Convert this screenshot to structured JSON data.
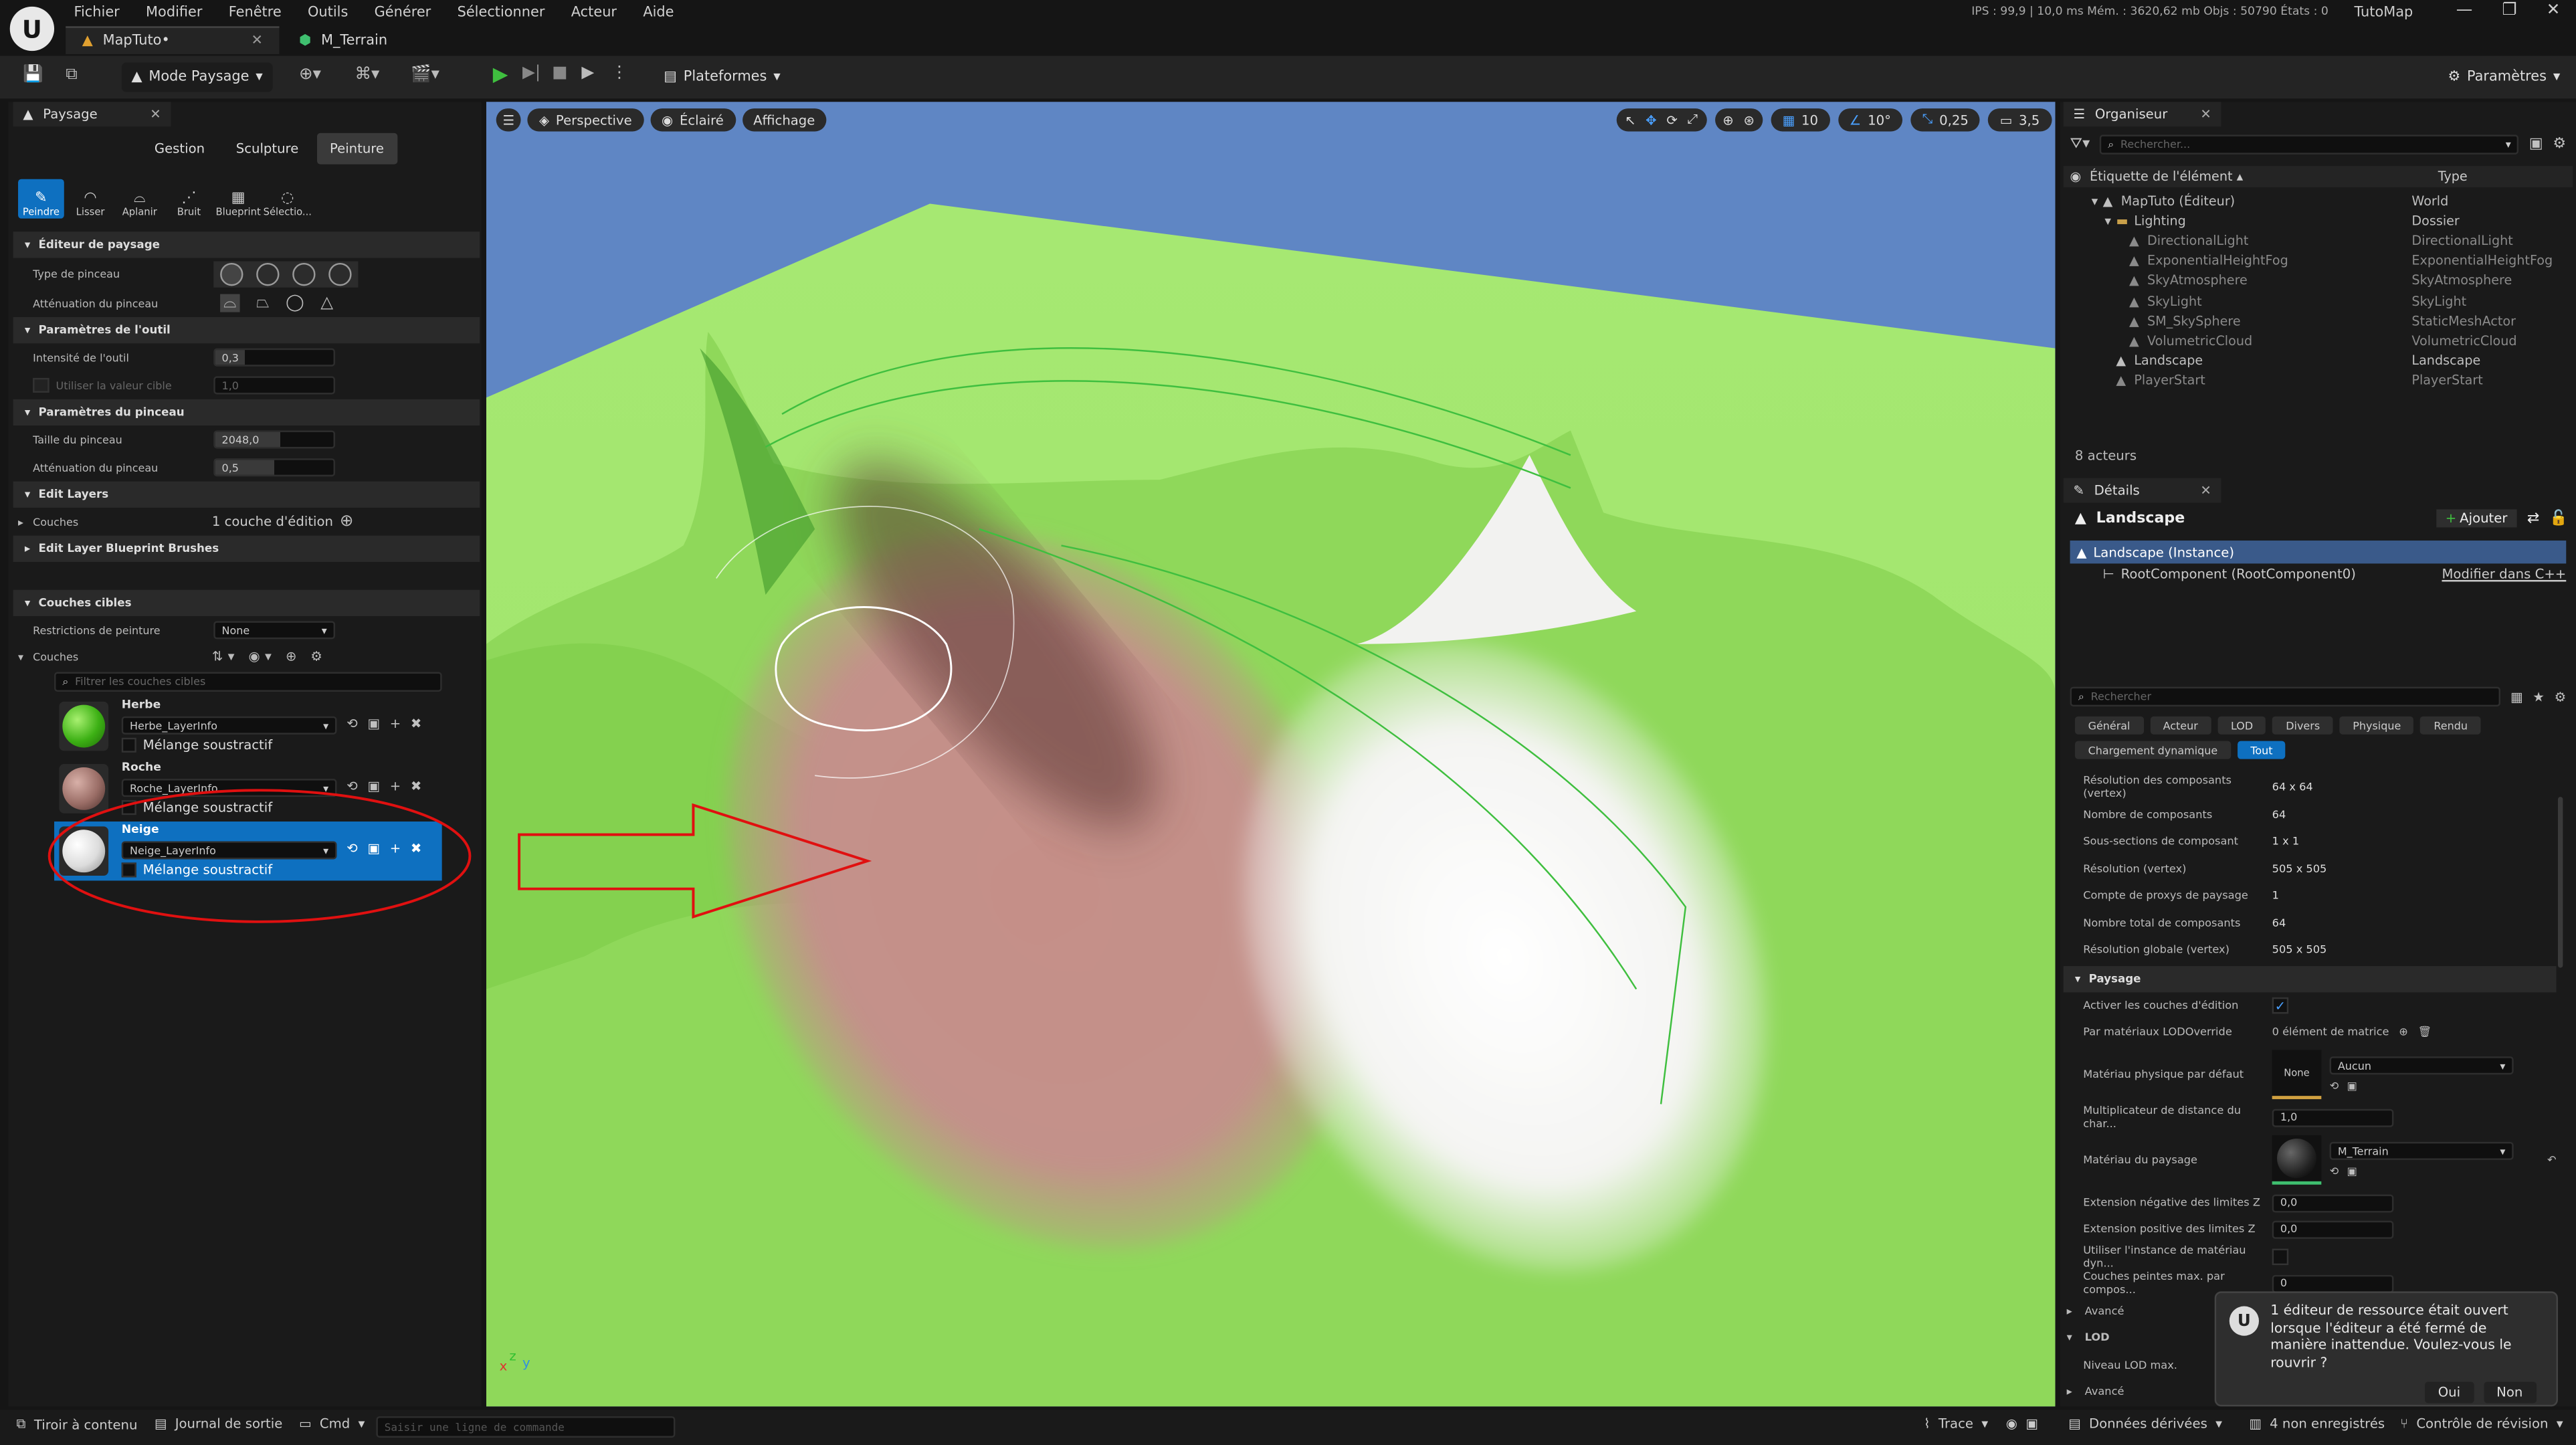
{
  "titlebar": {
    "menu": [
      "Fichier",
      "Modifier",
      "Fenêtre",
      "Outils",
      "Générer",
      "Sélectionner",
      "Acteur",
      "Aide"
    ],
    "tabs": [
      {
        "label": "MapTuto•",
        "active": true
      },
      {
        "label": "M_Terrain",
        "active": false
      }
    ],
    "stats": "IPS : 99,9  |  10,0 ms   Mém. : 3620,62 mb   Objs : 50790   États : 0",
    "project": "TutoMap",
    "window_buttons": [
      "—",
      "❐",
      "✕"
    ]
  },
  "toolbar": {
    "mode": "Mode Paysage",
    "platforms": "Plateformes",
    "settings": "Paramètres"
  },
  "left_panel": {
    "tab": "Paysage",
    "modes": [
      "Gestion",
      "Sculpture",
      "Peinture"
    ],
    "active_mode": "Peinture",
    "tools": [
      "Peindre",
      "Lisser",
      "Aplanir",
      "Bruit",
      "Blueprint",
      "Sélectio..."
    ],
    "sections": {
      "editor": "Éditeur de paysage",
      "tool_params": "Paramètres de l'outil",
      "brush_params": "Paramètres du pinceau",
      "edit_layers": "Edit Layers",
      "bp_brushes": "Edit Layer Blueprint Brushes",
      "target_layers": "Couches cibles"
    },
    "props": {
      "brush_type": "Type de pinceau",
      "brush_falloff": "Atténuation du pinceau",
      "tool_strength_label": "Intensité de l'outil",
      "tool_strength": "0,3",
      "use_target_label": "Utiliser la valeur cible",
      "use_target": "1,0",
      "brush_size_label": "Taille du pinceau",
      "brush_size": "2048,0",
      "brush_falloff2_label": "Atténuation du pinceau",
      "brush_falloff2": "0,5",
      "layers_label": "Couches",
      "layers_value": "1 couche d'édition",
      "paint_restrict_label": "Restrictions de peinture",
      "paint_restrict": "None",
      "target_layers_label": "Couches",
      "filter_placeholder": "Filtrer les couches cibles"
    },
    "layers": [
      {
        "name": "Herbe",
        "info": "Herbe_LayerInfo",
        "blend": "Mélange soustractif",
        "color": "#5fd12a"
      },
      {
        "name": "Roche",
        "info": "Roche_LayerInfo",
        "blend": "Mélange soustractif",
        "color": "#9a6d66"
      },
      {
        "name": "Neige",
        "info": "Neige_LayerInfo",
        "blend": "Mélange soustractif",
        "color": "#eeeeee"
      }
    ]
  },
  "viewport": {
    "perspective": "Perspective",
    "lighting": "Éclairé",
    "show": "Affichage",
    "grid_snap": "10",
    "rot_snap": "10°",
    "scale_snap": "0,25",
    "cam_speed": "3,5"
  },
  "outliner": {
    "tab": "Organiseur",
    "search_placeholder": "Rechercher...",
    "col_label": "Étiquette de l'élément",
    "col_type": "Type",
    "items": [
      {
        "label": "MapTuto (Éditeur)",
        "type": "World",
        "indent": 1,
        "dim": false
      },
      {
        "label": "Lighting",
        "type": "Dossier",
        "indent": 2,
        "dim": false
      },
      {
        "label": "DirectionalLight",
        "type": "DirectionalLight",
        "indent": 3,
        "dim": true
      },
      {
        "label": "ExponentialHeightFog",
        "type": "ExponentialHeightFog",
        "indent": 3,
        "dim": true
      },
      {
        "label": "SkyAtmosphere",
        "type": "SkyAtmosphere",
        "indent": 3,
        "dim": true
      },
      {
        "label": "SkyLight",
        "type": "SkyLight",
        "indent": 3,
        "dim": true
      },
      {
        "label": "SM_SkySphere",
        "type": "StaticMeshActor",
        "indent": 3,
        "dim": true
      },
      {
        "label": "VolumetricCloud",
        "type": "VolumetricCloud",
        "indent": 3,
        "dim": true
      },
      {
        "label": "Landscape",
        "type": "Landscape",
        "indent": 2,
        "dim": false
      },
      {
        "label": "PlayerStart",
        "type": "PlayerStart",
        "indent": 2,
        "dim": true
      }
    ],
    "count": "8 acteurs"
  },
  "details": {
    "tab": "Détails",
    "title": "Landscape",
    "add": "Ajouter",
    "instance": "Landscape (Instance)",
    "root": "RootComponent (RootComponent0)",
    "edit_cpp": "Modifier dans C++",
    "search_placeholder": "Rechercher",
    "filters": [
      "Général",
      "Acteur",
      "LOD",
      "Divers",
      "Physique",
      "Rendu",
      "Chargement dynamique",
      "Tout"
    ],
    "active_filter": "Tout",
    "info_rows": [
      {
        "label": "Résolution des composants (vertex)",
        "value": "64 x 64"
      },
      {
        "label": "Nombre de composants",
        "value": "64"
      },
      {
        "label": "Sous-sections de composant",
        "value": "1 x 1"
      },
      {
        "label": "Résolution (vertex)",
        "value": "505 x 505"
      },
      {
        "label": "Compte de proxys de paysage",
        "value": "1"
      },
      {
        "label": "Nombre total de composants",
        "value": "64"
      },
      {
        "label": "Résolution globale (vertex)",
        "value": "505 x 505"
      }
    ],
    "paysage_section": "Paysage",
    "enable_layers": "Activer les couches d'édition",
    "lod_override_label": "Par matériaux LODOverride",
    "lod_override": "0 élément de matrice",
    "phys_label": "Matériau physique par défaut",
    "phys_thumb": "None",
    "phys_value": "Aucun",
    "dist_label": "Multiplicateur de distance du char...",
    "dist_value": "1,0",
    "mat_label": "Matériau du paysage",
    "mat_value": "M_Terrain",
    "negz_label": "Extension négative des limites Z",
    "negz_value": "0,0",
    "posz_label": "Extension positive des limites Z",
    "posz_value": "0,0",
    "dyn_label": "Utiliser l'instance de matériau dyn...",
    "maxlayers_label": "Couches peintes max. par compos...",
    "maxlayers_value": "0",
    "advanced": "Avancé",
    "lod_section": "LOD",
    "lod_max": "Niveau LOD max.",
    "advanced2": "Avancé"
  },
  "toast": {
    "message": "1 éditeur de ressource était ouvert lorsque l'éditeur a été fermé de manière inattendue. Voulez-vous le rouvrir ?",
    "yes": "Oui",
    "no": "Non"
  },
  "bottombar": {
    "drawer": "Tiroir à contenu",
    "log": "Journal de sortie",
    "cmd": "Cmd",
    "cmd_placeholder": "Saisir une ligne de commande",
    "trace": "Trace",
    "derived": "Données dérivées",
    "unsaved": "4 non enregistrés",
    "revision": "Contrôle de révision"
  }
}
